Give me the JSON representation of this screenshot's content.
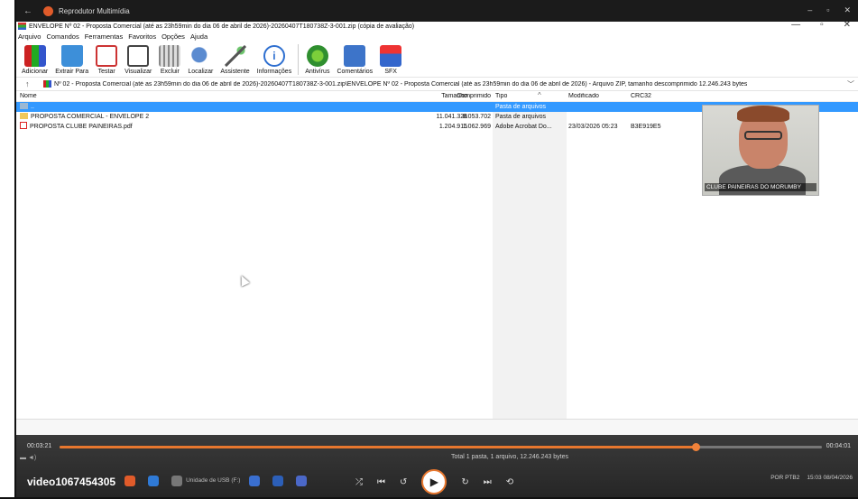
{
  "player": {
    "title": "Reprodutor Multimídia",
    "back_label": "←",
    "minimize_label": "–",
    "restore_label": "▫",
    "close_label": "✕",
    "current_time": "00:03:21",
    "total_time": "00:04:01",
    "progress_fraction": 0.834,
    "video_name": "video1067454305",
    "prev_label": "⏮",
    "rewind_label": "↺",
    "play_label": "▶",
    "forward_label": "↻",
    "next_label": "⏭",
    "shuffle_label": "⤮",
    "repeat_label": "⟲",
    "mini_label": "▬ ◄)"
  },
  "app": {
    "title": "ENVELOPE Nº 02 - Proposta Comercial (até as 23h59min do dia 06 de abril de 2026)-20260407T180738Z-3-001.zip (cópia de avaliação)",
    "win_minimize": "—",
    "win_restore": "▫",
    "win_close": "✕",
    "menu": [
      "Arquivo",
      "Comandos",
      "Ferramentas",
      "Favoritos",
      "Opções",
      "Ajuda"
    ],
    "toolbar": [
      {
        "label": "Adicionar",
        "icon": "add-icon",
        "cls": "i-add"
      },
      {
        "label": "Extrair Para",
        "icon": "extract-icon",
        "cls": "i-extract"
      },
      {
        "label": "Testar",
        "icon": "test-icon",
        "cls": "i-test"
      },
      {
        "label": "Visualizar",
        "icon": "view-icon",
        "cls": "i-view"
      },
      {
        "label": "Excluir",
        "icon": "delete-icon",
        "cls": "i-delete"
      },
      {
        "label": "Localizar",
        "icon": "find-icon",
        "cls": "i-find"
      },
      {
        "label": "Assistente",
        "icon": "wizard-icon",
        "cls": "i-wizard"
      },
      {
        "label": "Informações",
        "icon": "info-icon",
        "cls": "i-info"
      }
    ],
    "toolbar2": [
      {
        "label": "Antivírus",
        "icon": "antivirus-icon",
        "cls": "i-av"
      },
      {
        "label": "Comentários",
        "icon": "comments-icon",
        "cls": "i-comments"
      },
      {
        "label": "SFX",
        "icon": "sfx-icon",
        "cls": "i-sfx"
      }
    ],
    "address": "Nº 02 - Proposta Comercial (até as 23h59min do dia 06 de abril de 2026)-20260407T180738Z-3-001.zip\\ENVELOPE Nº 02 - Proposta Comercial (até as 23h59min do dia 06 de abril de 2026) - Arquivo ZIP, tamanho descomprimido 12.246.243 bytes",
    "address_up": "↑",
    "address_chevron": "﹀",
    "columns": {
      "name": "Nome",
      "size": "Tamanho",
      "packed": "Comprimido",
      "type": "Tipo",
      "modified": "Modificado",
      "crc": "CRC32"
    },
    "sort_arrow": "^",
    "rows": [
      {
        "name": "..",
        "size": "",
        "packed": "",
        "type": "Pasta de arquivos",
        "modified": "",
        "crc": "",
        "kind": "up",
        "selected": true
      },
      {
        "name": "PROPOSTA COMERCIAL - ENVELOPE 2",
        "size": "11.041.328",
        "packed": "8.053.702",
        "type": "Pasta de arquivos",
        "modified": "",
        "crc": "",
        "kind": "folder",
        "selected": false
      },
      {
        "name": "PROPOSTA CLUBE PAINEIRAS.pdf",
        "size": "1.204.915",
        "packed": "1.062.969",
        "type": "Adobe Acrobat Do...",
        "modified": "23/03/2026 05:23",
        "crc": "B3E919E5",
        "kind": "pdf",
        "selected": false
      }
    ],
    "status": "Total 1 pasta, 1 arquivo, 12.246.243 bytes"
  },
  "webcam": {
    "label": "CLUBE PAINEIRAS DO MORUMBY"
  },
  "taskbar": {
    "items": [
      {
        "label": "",
        "color": "#e05b2a"
      },
      {
        "label": "",
        "color": "#2f7ad6"
      },
      {
        "label": "Unidade de USB (F:)",
        "color": "#777"
      },
      {
        "label": "",
        "color": "#3a6fd0"
      },
      {
        "label": "",
        "color": "#2c5fb8"
      },
      {
        "label": "",
        "color": "#4b68c8"
      }
    ],
    "lang": "POR",
    "lang2": "PTB2",
    "clock_time": "15:03",
    "clock_date": "08/04/2026"
  }
}
